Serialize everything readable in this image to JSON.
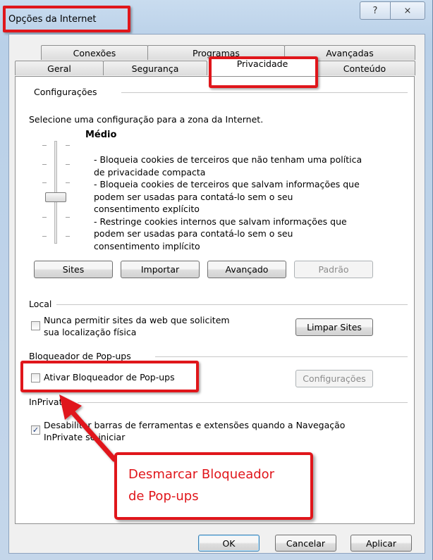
{
  "window": {
    "title": "Opções da Internet",
    "help_glyph": "?",
    "close_glyph": "⨯"
  },
  "tabs": {
    "row1": [
      "Conexões",
      "Programas",
      "Avançadas"
    ],
    "row2": [
      "Geral",
      "Segurança",
      "Privacidade",
      "Conteúdo"
    ],
    "active": "Privacidade"
  },
  "settings": {
    "section_title": "Configurações",
    "instruction": "Selecione uma configuração para a zona da Internet.",
    "level": "Médio",
    "description_lines": [
      "- Bloqueia cookies de terceiros que não tenham uma política",
      "de privacidade compacta",
      "- Bloqueia cookies de terceiros que salvam informações que",
      "podem ser usadas para contatá-lo sem o seu",
      "consentimento explícito",
      "- Restringe cookies internos que salvam informações que",
      "podem ser usadas para contatá-lo sem o seu",
      "consentimento implícito"
    ],
    "buttons": {
      "sites": "Sites",
      "import": "Importar",
      "advanced": "Avançado",
      "default": "Padrão"
    }
  },
  "location": {
    "section_title": "Local",
    "checkbox_line1": "Nunca permitir sites da web que solicitem",
    "checkbox_line2": "sua localização física",
    "checked": false,
    "clear_button": "Limpar Sites"
  },
  "popup": {
    "section_title": "Bloqueador de Pop-ups",
    "checkbox_label": "Ativar Bloqueador de Pop-ups",
    "checked": false,
    "settings_button": "Configurações"
  },
  "inprivate": {
    "section_title": "InPrivate",
    "checkbox_line1": "Desabilitar barras de ferramentas e extensões quando a Navegação",
    "checkbox_line2": "InPrivate se iniciar",
    "checked": true,
    "check_glyph": "✓"
  },
  "annotation": {
    "callout_line1": "Desmarcar Bloqueador",
    "callout_line2": "de Pop-ups",
    "color": "#e0161b"
  },
  "footer": {
    "ok": "OK",
    "cancel": "Cancelar",
    "apply": "Aplicar"
  }
}
